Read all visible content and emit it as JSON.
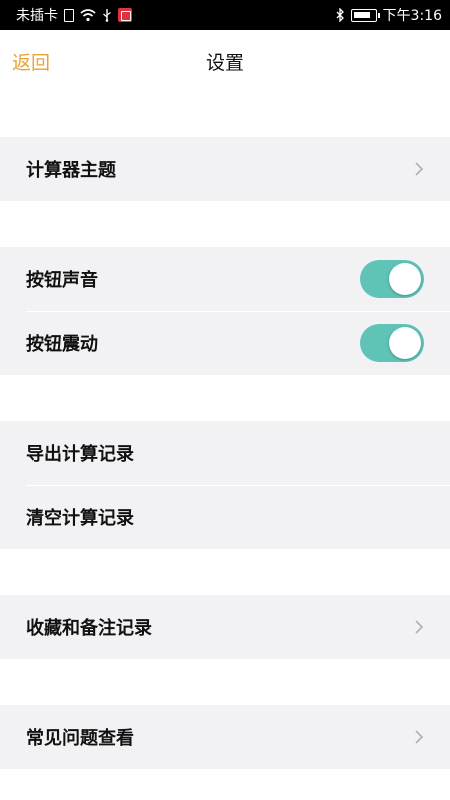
{
  "status_bar": {
    "carrier": "未插卡",
    "time": "下午3:16",
    "battery_level": 0.85,
    "icons": [
      "sim-icon",
      "wifi-icon",
      "usb-icon",
      "screen-record-icon",
      "bluetooth-icon",
      "battery-icon"
    ]
  },
  "nav": {
    "back_label": "返回",
    "title": "设置"
  },
  "groups": {
    "theme": {
      "label": "计算器主题"
    },
    "sound": {
      "label": "按钮声音",
      "enabled": true
    },
    "vibration": {
      "label": "按钮震动",
      "enabled": true
    },
    "export": {
      "label": "导出计算记录"
    },
    "clear": {
      "label": "清空计算记录"
    },
    "favorites": {
      "label": "收藏和备注记录"
    },
    "faq": {
      "label": "常见问题查看"
    }
  },
  "colors": {
    "accent": "#e8a33a",
    "toggle_on": "#5fc4b6",
    "group_bg": "#f2f2f4",
    "chevron": "#b0b0b4"
  }
}
